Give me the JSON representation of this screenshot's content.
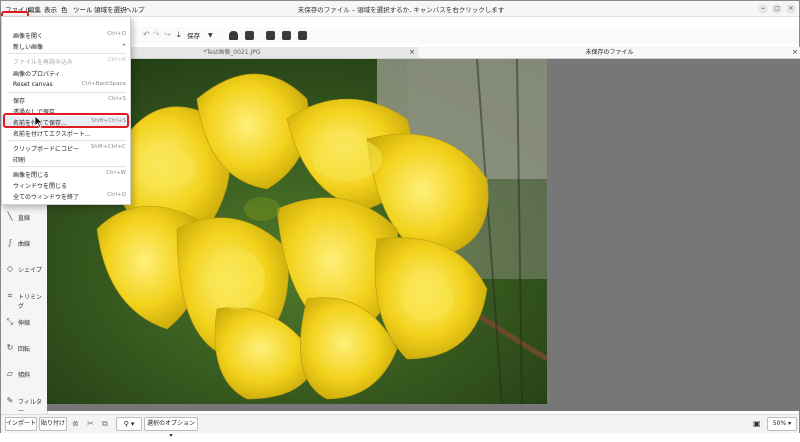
{
  "app": {
    "title": "未保存のファイル – 領域を選択するか, キャンバスを右クリックします",
    "window_controls": [
      "−",
      "□",
      "×"
    ]
  },
  "menubar": {
    "items": [
      "ファイル",
      "編集",
      "表示",
      "色",
      "ツール",
      "領域を選択",
      "ヘルプ"
    ]
  },
  "toolbar": {
    "save_label": "保存",
    "icons": [
      "undo-icon",
      "redo-icon",
      "download-icon",
      "print-icon",
      "share-icon",
      "zoom-out-icon",
      "zoom-in-icon",
      "fit-icon"
    ]
  },
  "tabs": [
    {
      "label": "*Test画像_0021.JPG",
      "close": "×"
    },
    {
      "label": "未保存のファイル",
      "close": "×"
    }
  ],
  "file_menu": {
    "items": [
      {
        "label": "画像を開く",
        "shortcut": "Ctrl+O",
        "disabled": false
      },
      {
        "label": "新しい画像",
        "shortcut": "▸",
        "disabled": false
      },
      {
        "label": "ファイルを再読み込み",
        "shortcut": "Ctrl+R",
        "disabled": true
      },
      {
        "label": "画像のプロパティ",
        "shortcut": "",
        "disabled": false
      },
      {
        "label": "Reset canvas",
        "shortcut": "Ctrl+BackSpace",
        "disabled": false
      },
      {
        "label": "保存",
        "shortcut": "Ctrl+S",
        "disabled": false
      },
      {
        "label": "透過なしで保存",
        "shortcut": "",
        "disabled": false
      },
      {
        "label": "名前を付けて保存…",
        "shortcut": "Shift+Ctrl+S",
        "disabled": false
      },
      {
        "label": "名前を付けてエクスポート…",
        "shortcut": "",
        "disabled": false
      },
      {
        "label": "クリップボードにコピー",
        "shortcut": "Shift+Ctrl+C",
        "disabled": false
      },
      {
        "label": "印刷",
        "shortcut": "",
        "disabled": false
      },
      {
        "label": "画像を閉じる",
        "shortcut": "Ctrl+W",
        "disabled": false
      },
      {
        "label": "ウィンドウを閉じる",
        "shortcut": "",
        "disabled": false
      },
      {
        "label": "全てのウィンドウを終了",
        "shortcut": "Ctrl+Q",
        "disabled": false
      }
    ]
  },
  "sidebar": {
    "tools": [
      {
        "label": "直線",
        "icon": "line-icon"
      },
      {
        "label": "曲線",
        "icon": "curve-icon"
      },
      {
        "label": "シェイプ",
        "icon": "shape-icon"
      },
      {
        "label": "トリミング",
        "icon": "crop-icon"
      },
      {
        "label": "伸縮",
        "icon": "scale-icon"
      },
      {
        "label": "回転",
        "icon": "rotate-icon"
      },
      {
        "label": "傾斜",
        "icon": "skew-icon"
      },
      {
        "label": "フィルター",
        "icon": "filter-icon"
      }
    ]
  },
  "bottombar": {
    "import_label": "インポート",
    "paste_label": "貼り付け",
    "options_label": "選択のオプション",
    "zoom": "50%"
  },
  "colors": {
    "highlight": "#e01b24",
    "canvas_bg": "#777777",
    "flower": "#f2d21b"
  }
}
